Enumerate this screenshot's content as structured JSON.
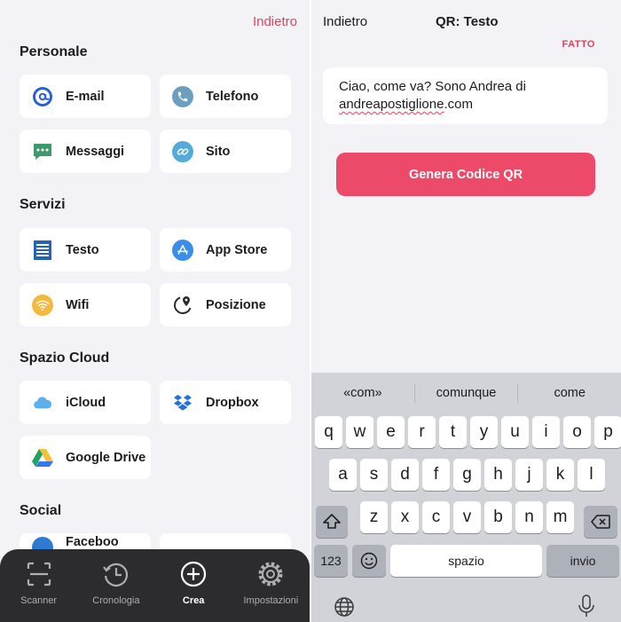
{
  "left": {
    "back_label": "Indietro",
    "sections": [
      {
        "title": "Personale",
        "items": [
          {
            "label": "E-mail",
            "icon": "at-sign-icon"
          },
          {
            "label": "Telefono",
            "icon": "phone-icon"
          },
          {
            "label": "Messaggi",
            "icon": "message-bubble-icon"
          },
          {
            "label": "Sito",
            "icon": "link-icon"
          }
        ]
      },
      {
        "title": "Servizi",
        "items": [
          {
            "label": "Testo",
            "icon": "document-text-icon"
          },
          {
            "label": "App Store",
            "icon": "app-store-icon"
          },
          {
            "label": "Wifi",
            "icon": "wifi-icon"
          },
          {
            "label": "Posizione",
            "icon": "location-pin-icon"
          }
        ]
      },
      {
        "title": "Spazio Cloud",
        "items": [
          {
            "label": "iCloud",
            "icon": "icloud-icon"
          },
          {
            "label": "Dropbox",
            "icon": "dropbox-icon"
          },
          {
            "label": "Google Drive",
            "icon": "google-drive-icon"
          }
        ]
      },
      {
        "title": "Social",
        "items": [
          {
            "label": "Faceboo",
            "icon": "facebook-icon"
          }
        ]
      }
    ],
    "tabs": [
      {
        "label": "Scanner",
        "icon": "scanner-icon",
        "active": false
      },
      {
        "label": "Cronologia",
        "icon": "history-clock-icon",
        "active": false
      },
      {
        "label": "Crea",
        "icon": "plus-circle-icon",
        "active": true
      },
      {
        "label": "Impostazioni",
        "icon": "gear-icon",
        "active": false
      }
    ]
  },
  "right": {
    "back_label": "Indietro",
    "title": "QR: Testo",
    "done_label": "FATTO",
    "text_line1": "Ciao, come va? Sono Andrea di",
    "text_line2": "andreapostiglione",
    "text_line2_suffix": ".com",
    "generate_label": "Genera Codice QR"
  },
  "keyboard": {
    "suggestions": [
      "«com»",
      "comunque",
      "come"
    ],
    "row1": [
      "q",
      "w",
      "e",
      "r",
      "t",
      "y",
      "u",
      "i",
      "o",
      "p"
    ],
    "row2": [
      "a",
      "s",
      "d",
      "f",
      "g",
      "h",
      "j",
      "k",
      "l"
    ],
    "row3": [
      "z",
      "x",
      "c",
      "v",
      "b",
      "n",
      "m"
    ],
    "numbers_label": "123",
    "space_label": "spazio",
    "return_label": "invio"
  },
  "colors": {
    "accent": "#e1435f",
    "button": "#ec4a68",
    "background": "#f2f2f7",
    "tabbar": "#2c2c2e",
    "keyboard": "#d1d3d9"
  }
}
